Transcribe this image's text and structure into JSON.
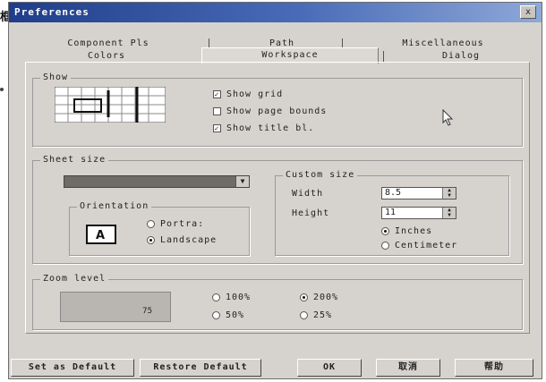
{
  "window": {
    "title": "Preferences",
    "close_label": "x"
  },
  "side_glyph": "框",
  "tabs": {
    "row1": [
      "Component Pls",
      "Path",
      "Miscellaneous"
    ],
    "row2": [
      "Colors",
      "Workspace",
      "Dialog"
    ],
    "active": "Workspace"
  },
  "show": {
    "title": "Show",
    "options": [
      {
        "label": "Show grid",
        "checked": true
      },
      {
        "label": "Show page bounds",
        "checked": false
      },
      {
        "label": "Show title bl.",
        "checked": true
      }
    ]
  },
  "sheet_size": {
    "title": "Sheet size",
    "selected": "",
    "orientation": {
      "title": "Orientation",
      "options": [
        {
          "label": "Portra:",
          "checked": false
        },
        {
          "label": "Landscape",
          "checked": true
        }
      ]
    },
    "custom": {
      "title": "Custom size",
      "width_label": "Width",
      "width_value": "8.5",
      "height_label": "Height",
      "height_value": "11",
      "units": [
        {
          "label": "Inches",
          "checked": true
        },
        {
          "label": "Centimeter",
          "checked": false
        }
      ]
    }
  },
  "zoom": {
    "title": "Zoom level",
    "preview_value": "75",
    "options": [
      {
        "label": "100%",
        "checked": false
      },
      {
        "label": "200%",
        "checked": true
      },
      {
        "label": "50%",
        "checked": false
      },
      {
        "label": "25%",
        "checked": false
      }
    ]
  },
  "buttons": {
    "set_default": "Set as Default",
    "restore_default": "Restore Default",
    "ok": "OK",
    "cancel": "取消",
    "help": "帮助"
  },
  "colors": {
    "titlebar_start": "#1f3d8a",
    "titlebar_end": "#8ea8d8",
    "face": "#d6d3ce"
  }
}
